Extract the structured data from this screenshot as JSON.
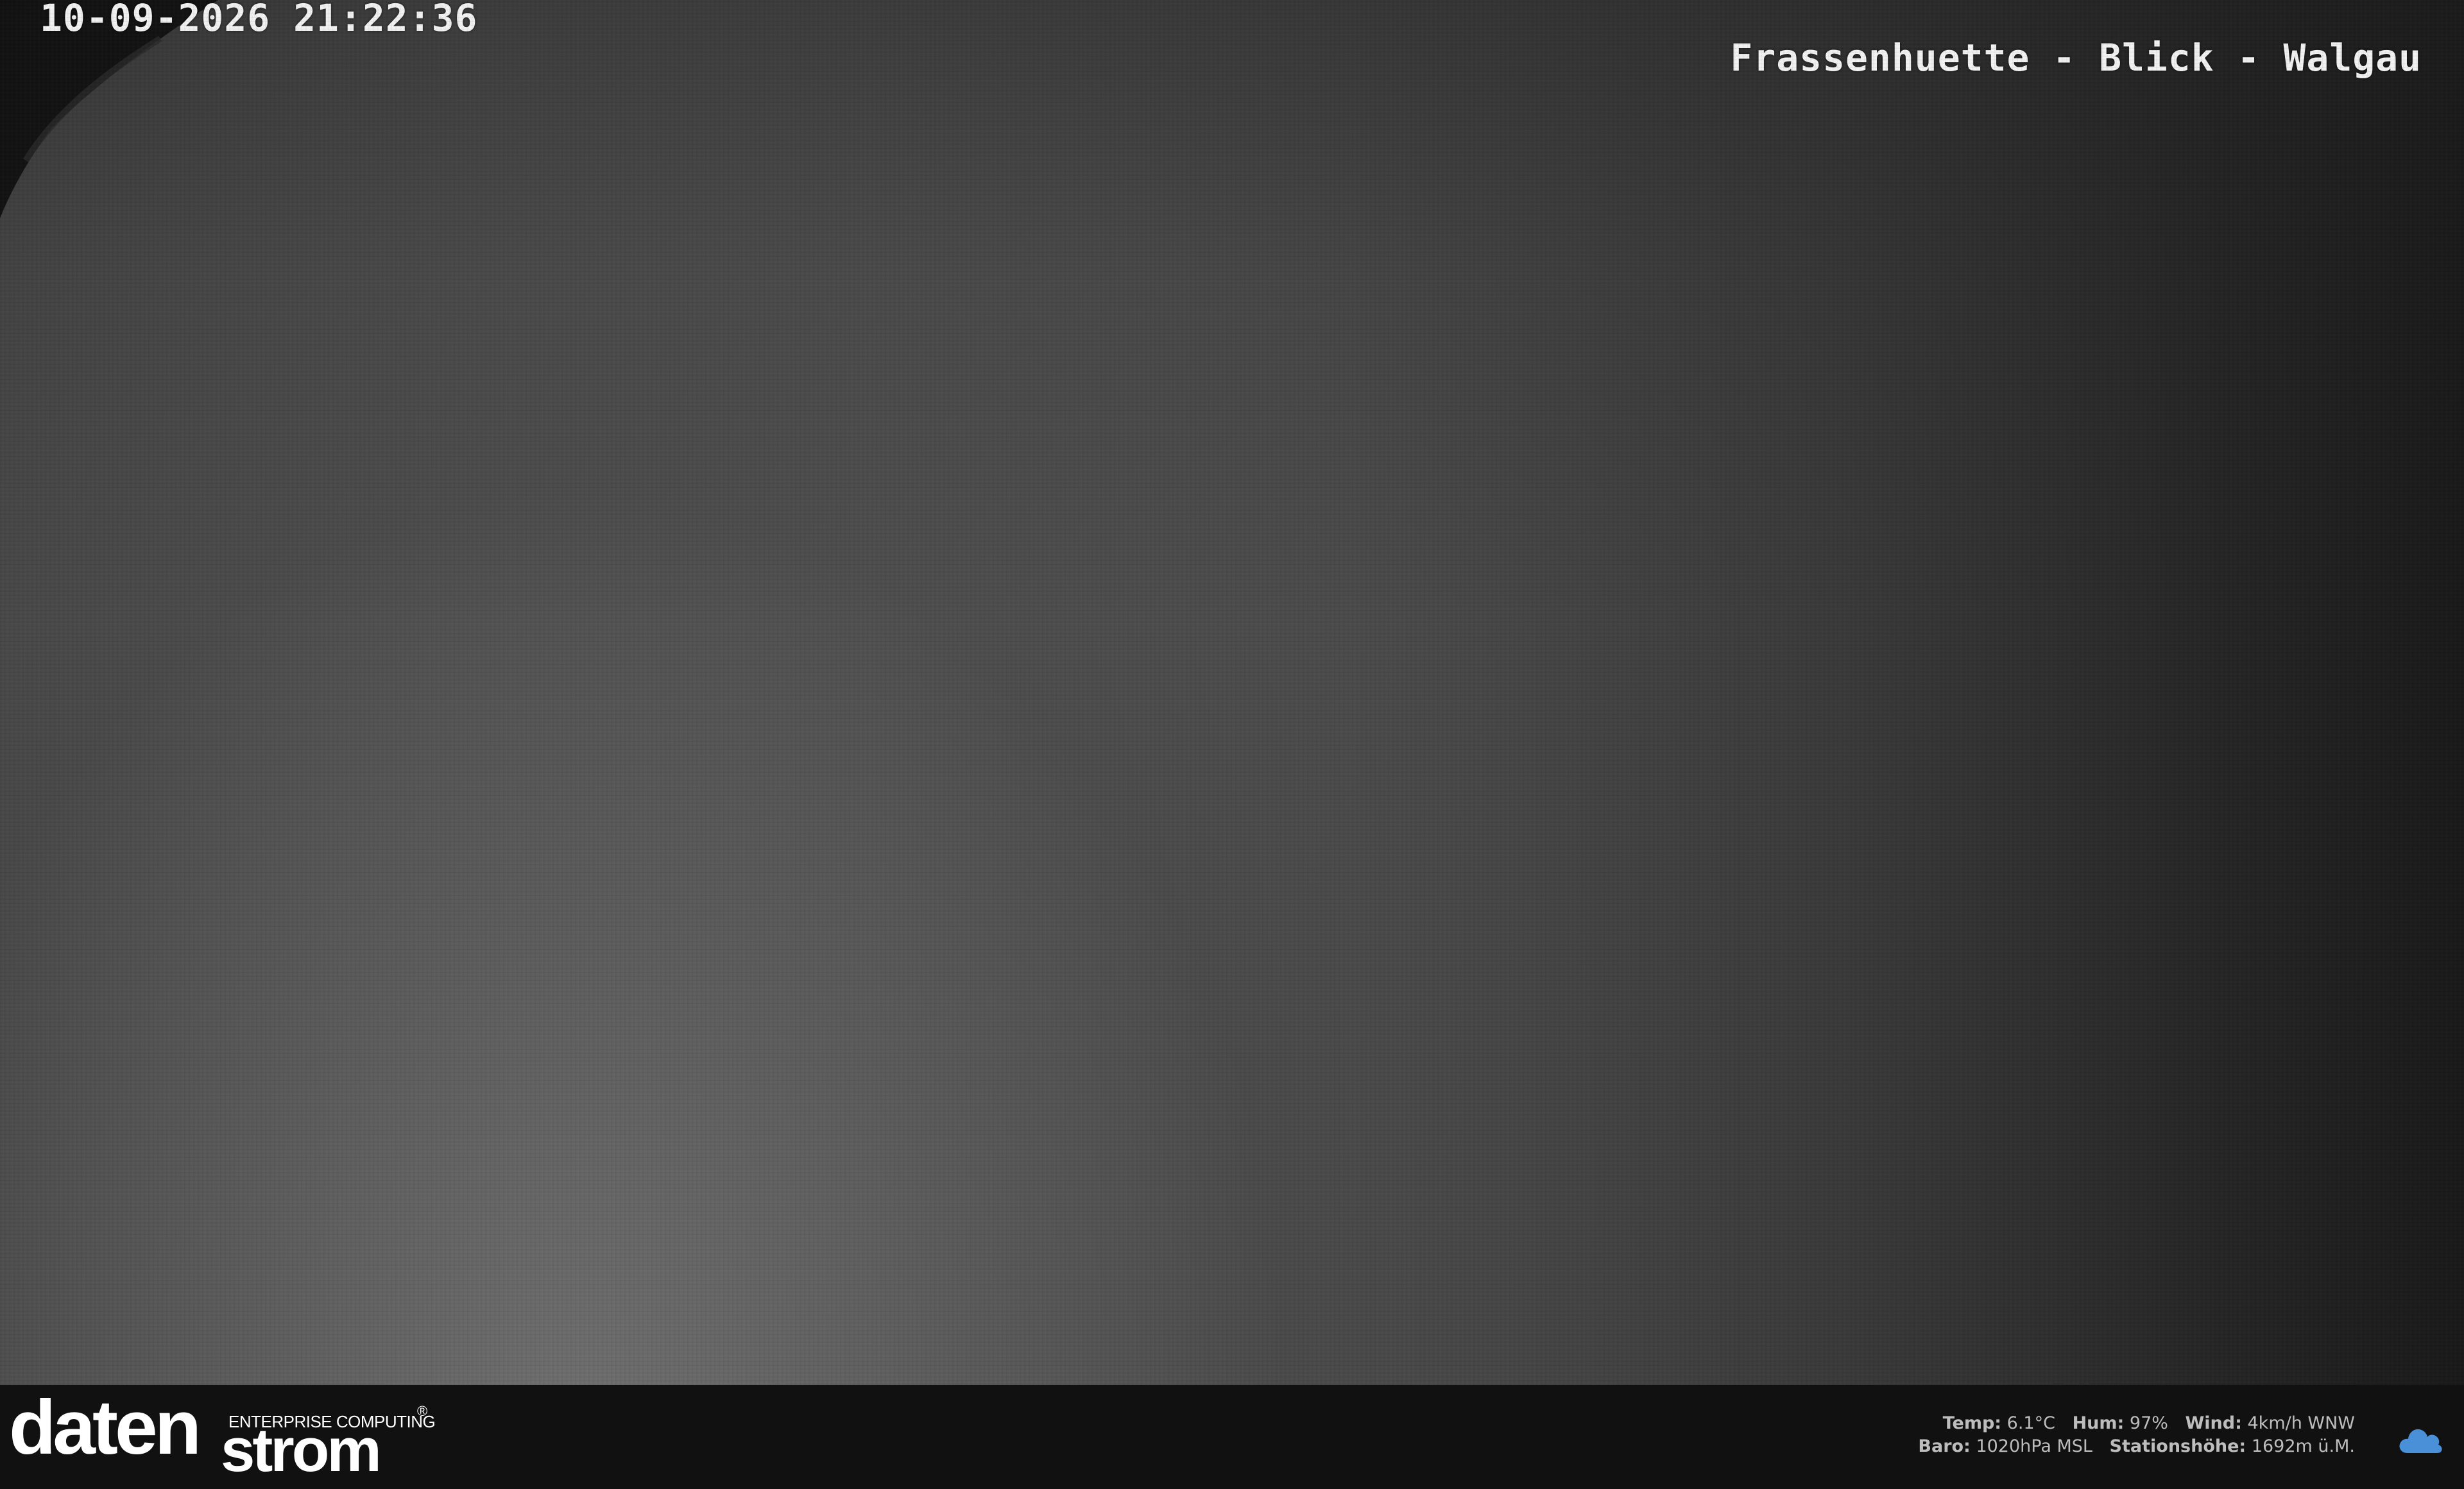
{
  "camera": {
    "timestamp": "10-09-2026 21:22:36",
    "location": "Frassenhuette - Blick - Walgau"
  },
  "footer": {
    "logo": {
      "main": "daten",
      "second": "strom",
      "tagline": "ENTERPRISE COMPUTING",
      "registered": "®"
    },
    "weather": {
      "temp_label": "Temp:",
      "temp_value": "6.1°C",
      "hum_label": "Hum:",
      "hum_value": "97%",
      "wind_label": "Wind:",
      "wind_value": "4km/h WNW",
      "baro_label": "Baro:",
      "baro_value": "1020hPa MSL",
      "station_label": "Stationshöhe:",
      "station_value": "1692m ü.M.",
      "icon": "cloud-icon",
      "icon_color": "#4a90d9"
    }
  }
}
